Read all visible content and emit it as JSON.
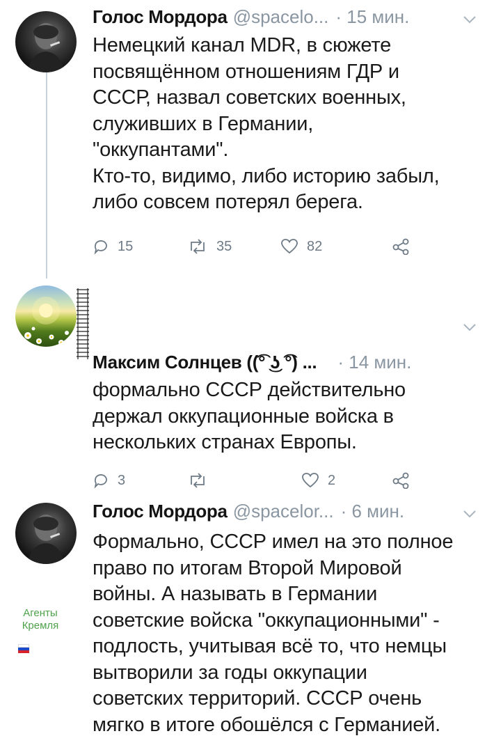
{
  "tweets": [
    {
      "author_name": "Голос Мордора",
      "handle": "@spacelo...",
      "time": "· 15 мин.",
      "text": "Немецкий канал MDR, в сюжете\nпосвящённом отношениям ГДР и\nСССР, назвал советских военных,\nслуживших в Германии,\n\"оккупантами\".\nКто-то, видимо, либо историю забыл,\nлибо совсем потерял берега.",
      "replies": "15",
      "retweets": "35",
      "likes": "82"
    },
    {
      "author_name": "Максим Солнцев ((͡° ͜ʖ ͡°) ...",
      "handle": "",
      "time": "· 14 мин.",
      "text": "формально СССР действительно\nдержал оккупационные войска в\nнескольких странах Европы.",
      "replies": "3",
      "retweets": "",
      "likes": "2"
    },
    {
      "author_name": "Голос Мордора",
      "handle": "@spacelor...",
      "time": "· 6 мин.",
      "text": "Формально, СССР имел на это полное\nправо по итогам Второй Мировой\nвойны. А называть в Германии\nсоветские войска \"оккупационными\" -\nподлость, учитывая всё то, что немцы\nвытворили за годы оккупации\nсоветских территорий. СССР очень\nмягко в итоге обошёлся с Германией.",
      "replies": "",
      "retweets": "",
      "likes": ""
    }
  ],
  "side_label": "Агенты\nКремля",
  "icons": {
    "reply": "reply-icon",
    "retweet": "retweet-icon",
    "like": "heart-icon",
    "share": "share-icon",
    "menu": "chevron-down-icon"
  },
  "colors": {
    "text": "#1a1a1a",
    "muted": "#8a96a1",
    "action": "#6d7a86",
    "thread_line": "#c9d2da",
    "side_label": "#4ea24a"
  }
}
